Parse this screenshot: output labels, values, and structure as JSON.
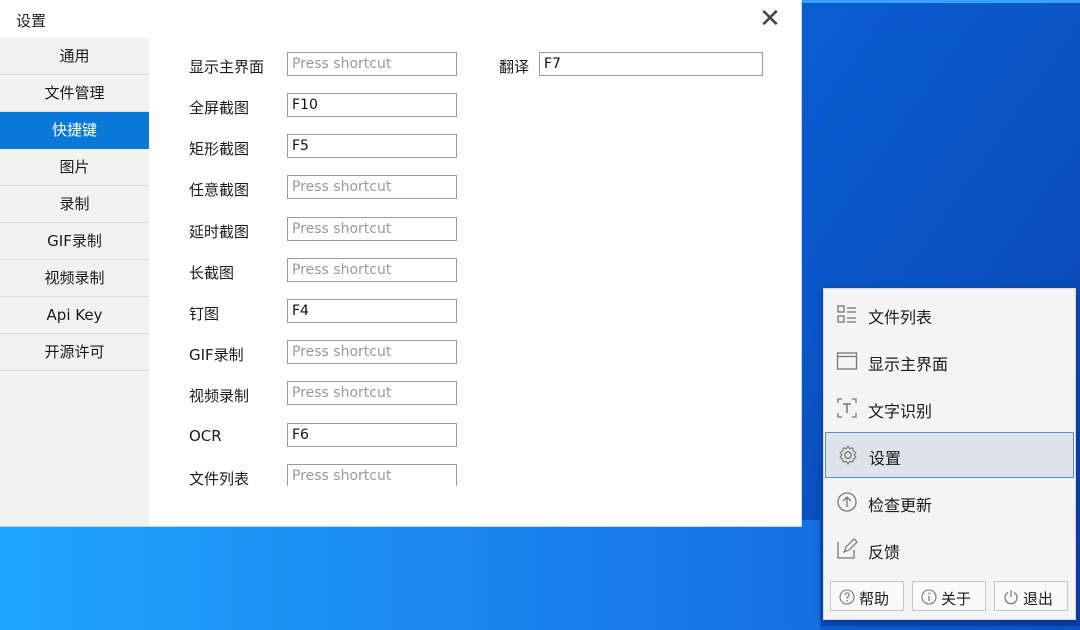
{
  "window": {
    "title": "设置",
    "close_glyph": "✕"
  },
  "sidebar": {
    "items": [
      {
        "label": "通用"
      },
      {
        "label": "文件管理"
      },
      {
        "label": "快捷键",
        "active": true
      },
      {
        "label": "图片"
      },
      {
        "label": "录制"
      },
      {
        "label": "GIF录制"
      },
      {
        "label": "视频录制"
      },
      {
        "label": "Api Key"
      },
      {
        "label": "开源许可"
      }
    ]
  },
  "shortcuts": {
    "placeholder": "Press shortcut",
    "items": [
      {
        "label": "显示主界面",
        "value": ""
      },
      {
        "label": "全屏截图",
        "value": "F10"
      },
      {
        "label": "矩形截图",
        "value": "F5"
      },
      {
        "label": "任意截图",
        "value": ""
      },
      {
        "label": "延时截图",
        "value": ""
      },
      {
        "label": "长截图",
        "value": ""
      },
      {
        "label": "钉图",
        "value": "F4"
      },
      {
        "label": "GIF录制",
        "value": ""
      },
      {
        "label": "视频录制",
        "value": ""
      },
      {
        "label": "OCR",
        "value": "F6"
      },
      {
        "label": "文件列表",
        "value": ""
      }
    ],
    "translate": {
      "label": "翻译",
      "value": "F7"
    }
  },
  "tray_menu": {
    "items": [
      {
        "label": "文件列表",
        "icon": "list-icon"
      },
      {
        "label": "显示主界面",
        "icon": "window-icon"
      },
      {
        "label": "文字识别",
        "icon": "text-recognition-icon"
      },
      {
        "label": "设置",
        "icon": "gear-icon",
        "hover": true
      },
      {
        "label": "检查更新",
        "icon": "arrow-up-circle-icon"
      },
      {
        "label": "反馈",
        "icon": "edit-icon"
      }
    ],
    "bottom": [
      {
        "label": "帮助",
        "icon": "help-icon"
      },
      {
        "label": "关于",
        "icon": "info-icon"
      },
      {
        "label": "退出",
        "icon": "power-icon"
      }
    ]
  },
  "colors": {
    "accent": "#0a78d7",
    "desktop": "#0b5fd0"
  }
}
